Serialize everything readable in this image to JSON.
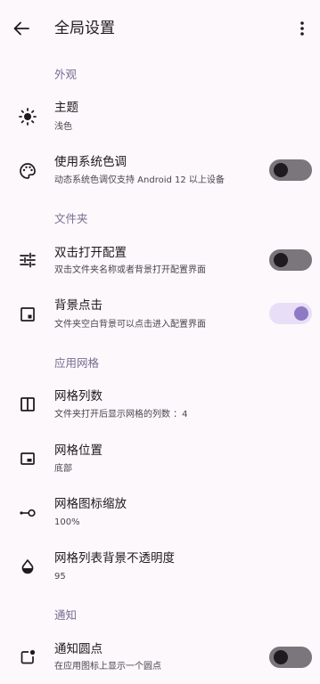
{
  "appbar": {
    "title": "全局设置",
    "back_icon": "arrow-left-icon",
    "menu_icon": "more-vertical-icon"
  },
  "sections": {
    "appearance": "外观",
    "folder": "文件夹",
    "grid": "应用网格",
    "notification": "通知"
  },
  "settings": {
    "theme": {
      "label": "主题",
      "value": "浅色",
      "icon": "sun-icon"
    },
    "system_color": {
      "label": "使用系统色调",
      "value": "动态系统色调仅支持 Android 12 以上设备",
      "icon": "palette-icon",
      "enabled": false
    },
    "double_click": {
      "label": "双击打开配置",
      "value": "双击文件夹名称或者背景打开配置界面",
      "icon": "sliders-icon",
      "enabled": false
    },
    "background_click": {
      "label": "背景点击",
      "value": "文件夹空白背景可以点击进入配置界面",
      "icon": "square-corner-icon",
      "enabled": true
    },
    "grid_columns": {
      "label": "网格列数",
      "value": "文件夹打开后显示网格的列数 ：4",
      "icon": "columns-icon"
    },
    "grid_position": {
      "label": "网格位置",
      "value": "底部",
      "icon": "bottom-panel-icon"
    },
    "grid_icon_scale": {
      "label": "网格图标缩放",
      "value": "100%",
      "icon": "scale-slider-icon"
    },
    "grid_bg_opacity": {
      "label": "网格列表背景不透明度",
      "value": "95",
      "icon": "opacity-drop-icon"
    },
    "notification_dot": {
      "label": "通知圆点",
      "value": "在应用图标上显示一个圆点",
      "icon": "notification-dot-icon",
      "enabled": false
    }
  },
  "colors": {
    "background": "#fdf8fb",
    "section_header": "#7a6b92",
    "switch_on_track": "#e8def8",
    "switch_on_knob": "#8e79c4",
    "switch_off_track": "#7b757c"
  }
}
